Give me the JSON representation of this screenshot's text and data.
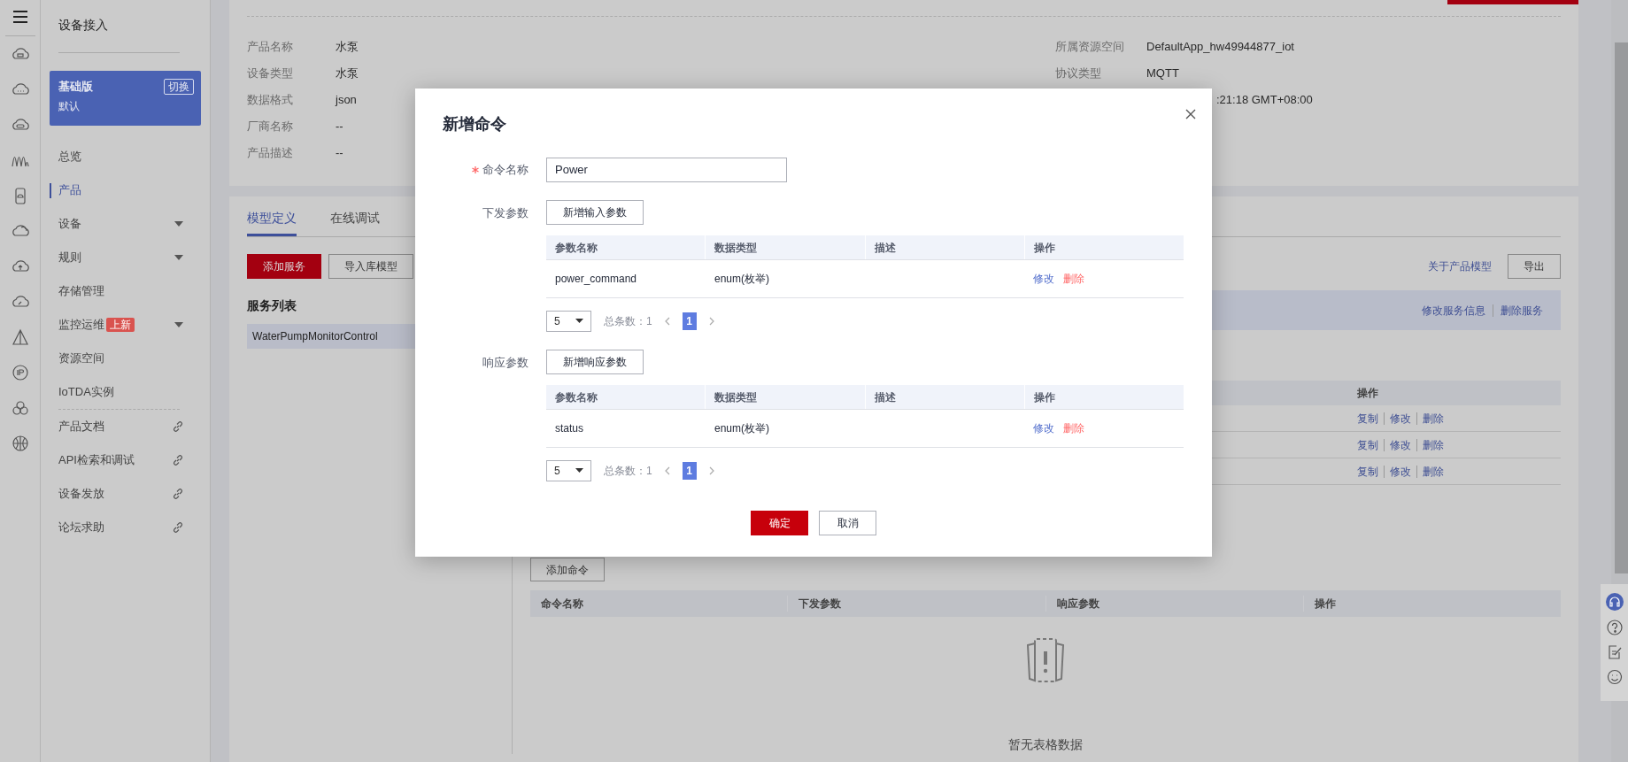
{
  "sidebar": {
    "title": "设备接入",
    "edition": {
      "name": "基础版",
      "switch_label": "切换",
      "instance": "默认"
    },
    "items": [
      {
        "label": "总览",
        "kind": "plain",
        "selected": false
      },
      {
        "label": "产品",
        "kind": "plain",
        "selected": true
      },
      {
        "label": "设备",
        "kind": "expand",
        "selected": false
      },
      {
        "label": "规则",
        "kind": "expand",
        "selected": false
      },
      {
        "label": "存储管理",
        "kind": "plain",
        "selected": false
      },
      {
        "label": "监控运维",
        "kind": "expand",
        "badge": "上新",
        "selected": false
      },
      {
        "label": "资源空间",
        "kind": "plain",
        "selected": false
      },
      {
        "label": "IoTDA实例",
        "kind": "plain",
        "selected": false
      },
      {
        "label": "产品文档",
        "kind": "external",
        "selected": false
      },
      {
        "label": "API检索和调试",
        "kind": "external",
        "selected": false
      },
      {
        "label": "设备发放",
        "kind": "external",
        "selected": false
      },
      {
        "label": "论坛求助",
        "kind": "external",
        "selected": false
      }
    ]
  },
  "product_info": {
    "left": [
      {
        "label": "产品名称",
        "value": "水泵"
      },
      {
        "label": "设备类型",
        "value": "水泵"
      },
      {
        "label": "数据格式",
        "value": "json"
      },
      {
        "label": "厂商名称",
        "value": "--"
      },
      {
        "label": "产品描述",
        "value": "--"
      }
    ],
    "right": [
      {
        "label": "所属资源空间",
        "value": "DefaultApp_hw49944877_iot"
      },
      {
        "label": "协议类型",
        "value": "MQTT"
      },
      {
        "value": ":21:18 GMT+08:00"
      }
    ]
  },
  "tabs": [
    {
      "label": "模型定义",
      "selected": true
    },
    {
      "label": "在线调试",
      "selected": false
    }
  ],
  "toolbar": {
    "buttons": [
      {
        "label": "添加服务",
        "kind": "primary"
      },
      {
        "label": "导入库模型",
        "kind": "secondary"
      }
    ],
    "about_link": "关于产品模型",
    "export_button": "导出"
  },
  "service_list": {
    "title": "服务列表",
    "items": [
      {
        "label": "WaterPumpMonitorControl",
        "selected": true
      }
    ]
  },
  "service_header": {
    "actions": [
      "修改服务信息",
      "删除服务"
    ]
  },
  "property_table": {
    "columns": [
      "操作"
    ],
    "rows": [
      {
        "actions": [
          "复制",
          "修改",
          "删除"
        ]
      },
      {
        "actions": [
          "复制",
          "修改",
          "删除"
        ]
      },
      {
        "actions": [
          "复制",
          "修改",
          "删除"
        ]
      }
    ]
  },
  "command_section": {
    "add_button": "添加命令",
    "columns": [
      "命令名称",
      "下发参数",
      "响应参数",
      "操作"
    ],
    "empty_text": "暂无表格数据"
  },
  "dialog": {
    "title": "新增命令",
    "name_field": {
      "label": "命令名称",
      "required": true,
      "value": "Power"
    },
    "sections": [
      {
        "label": "下发参数",
        "add_button": "新增输入参数",
        "columns": [
          "参数名称",
          "数据类型",
          "描述",
          "操作"
        ],
        "rows": [
          {
            "name": "power_command",
            "type": "enum(枚举)",
            "actions": [
              "修改",
              "删除"
            ]
          }
        ],
        "page_size": "5",
        "total": "总条数：1",
        "pages": [
          {
            "label": "1",
            "selected": true
          }
        ]
      },
      {
        "label": "响应参数",
        "add_button": "新增响应参数",
        "columns": [
          "参数名称",
          "数据类型",
          "描述",
          "操作"
        ],
        "rows": [
          {
            "name": "status",
            "type": "enum(枚举)",
            "actions": [
              "修改",
              "删除"
            ]
          }
        ],
        "page_size": "5",
        "total": "总条数：1",
        "pages": [
          {
            "label": "1",
            "selected": true
          }
        ]
      }
    ],
    "buttons": [
      {
        "label": "确定",
        "kind": "primary"
      },
      {
        "label": "取消",
        "kind": "secondary"
      }
    ]
  }
}
